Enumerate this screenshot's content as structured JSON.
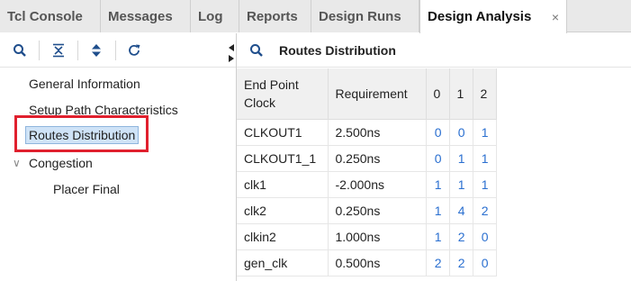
{
  "tabs": [
    {
      "label": "Tcl Console"
    },
    {
      "label": "Messages"
    },
    {
      "label": "Log"
    },
    {
      "label": "Reports"
    },
    {
      "label": "Design Runs"
    },
    {
      "label": "Design Analysis",
      "active": true
    }
  ],
  "close_glyph": "×",
  "left_toolbar": {
    "icons": [
      "search-icon",
      "collapse-all-icon",
      "expand-all-icon",
      "refresh-icon"
    ]
  },
  "tree": {
    "items": [
      {
        "label": "General Information"
      },
      {
        "label": "Setup Path Characteristics"
      },
      {
        "label": "Routes Distribution",
        "selected": true
      },
      {
        "label": "Congestion",
        "expanded": true
      },
      {
        "label": "Placer Final"
      }
    ]
  },
  "right": {
    "title": "Routes Distribution",
    "columns": [
      "End Point Clock",
      "Requirement",
      "0",
      "1",
      "2"
    ],
    "rows": [
      {
        "clock": "CLKOUT1",
        "req": "2.500ns",
        "c0": "0",
        "c1": "0",
        "c2": "1"
      },
      {
        "clock": "CLKOUT1_1",
        "req": "0.250ns",
        "c0": "0",
        "c1": "1",
        "c2": "1"
      },
      {
        "clock": "clk1",
        "req": "-2.000ns",
        "c0": "1",
        "c1": "1",
        "c2": "1"
      },
      {
        "clock": "clk2",
        "req": "0.250ns",
        "c0": "1",
        "c1": "4",
        "c2": "2"
      },
      {
        "clock": "clkin2",
        "req": "1.000ns",
        "c0": "1",
        "c1": "2",
        "c2": "0"
      },
      {
        "clock": "gen_clk",
        "req": "0.500ns",
        "c0": "2",
        "c1": "2",
        "c2": "0"
      }
    ]
  },
  "colors": {
    "highlight": "#e0202e",
    "selection": "#cfe3f7",
    "link_number": "#2a6fd0"
  }
}
